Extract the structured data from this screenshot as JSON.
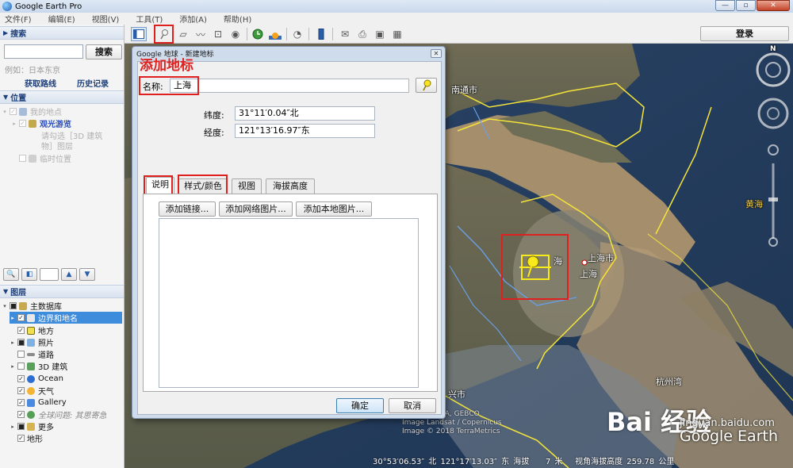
{
  "window": {
    "title": "Google Earth Pro",
    "buttons": [
      "—",
      "▫",
      "✕"
    ]
  },
  "menu": [
    "文件(F)",
    "编辑(E)",
    "视图(V)",
    "工具(T)",
    "添加(A)",
    "帮助(H)"
  ],
  "toolbar": {
    "login_label": "登录"
  },
  "sidebar": {
    "search": {
      "header": "搜索",
      "button": "搜索",
      "hint": "例如：日本东京",
      "links": [
        "获取路线",
        "历史记录"
      ]
    },
    "places": {
      "header": "位置",
      "items": [
        {
          "label": "我的地点",
          "checked": true
        },
        {
          "label": "观光游览",
          "checked": true
        },
        {
          "label": "请勾选［3D 建筑",
          "checked": null
        },
        {
          "label": "物］图层",
          "checked": null
        },
        {
          "label": "临时位置",
          "checked": false
        }
      ]
    },
    "layers": {
      "header": "图层",
      "items": [
        {
          "label": "主数据库",
          "checked": "partial",
          "selected": false
        },
        {
          "label": "边界和地名",
          "checked": true,
          "selected": true
        },
        {
          "label": "地方",
          "checked": true,
          "selected": false
        },
        {
          "label": "照片",
          "checked": "partial",
          "selected": false
        },
        {
          "label": "道路",
          "checked": false,
          "selected": false
        },
        {
          "label": "3D 建筑",
          "checked": false,
          "selected": false
        },
        {
          "label": "Ocean",
          "checked": true,
          "selected": false
        },
        {
          "label": "天气",
          "checked": true,
          "selected": false
        },
        {
          "label": "Gallery",
          "checked": true,
          "selected": false
        },
        {
          "label": "全球问题: 其思寄急",
          "checked": null,
          "selected": false
        },
        {
          "label": "更多",
          "checked": "partial",
          "selected": false
        },
        {
          "label": "地形",
          "checked": true,
          "selected": false
        }
      ]
    }
  },
  "dialog": {
    "title": "Google 地球 - 新建地标",
    "annotation": "添加地标",
    "name_label": "名称:",
    "name_value": "上海",
    "lat_label": "纬度:",
    "lat_value": "31°11′0.04″北",
    "lon_label": "经度:",
    "lon_value": "121°13′16.97″东",
    "tabs": [
      "说明",
      "样式/颜色",
      "视图",
      "海拔高度"
    ],
    "pane_buttons": [
      "添加链接...",
      "添加网络图片...",
      "添加本地图片..."
    ],
    "ok": "确定",
    "cancel": "取消"
  },
  "map": {
    "labels": {
      "nantong": "南通市",
      "huanghai": "黄海",
      "shanghai_city": "上海市",
      "shanghai": "上海",
      "hai": "海",
      "hangzhou_bay": "杭州湾",
      "xing_city": "兴市"
    },
    "credits": [
      "S, Navy, NGA, GEBCO",
      "Image Landsat / Copernicus",
      "Image © 2018 TerraMetrics"
    ],
    "brand": {
      "baidu": "Bai 经验",
      "url": "jingyan.baidu.com",
      "google": "Google Earth"
    },
    "status": {
      "lat": "30°53′06.53″ 北",
      "lon": "121°17′13.03″ 东",
      "elev_label": "海拔",
      "elev_value": "7 米",
      "eye_label": "视角海拔高度",
      "eye_value": "259.78 公里"
    },
    "compass_north": "N"
  },
  "colors": {
    "highlight": "#e0201e",
    "pin": "#ffe600",
    "selection": "#3e8ddd"
  }
}
